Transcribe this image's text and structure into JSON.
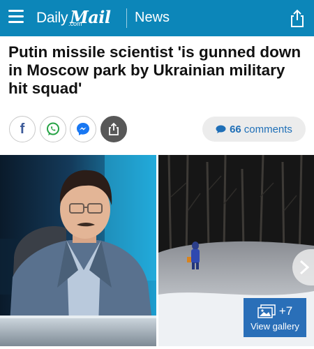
{
  "header": {
    "logo_daily": "Daily",
    "logo_mail": "Mail",
    "logo_com": ".com",
    "section": "News",
    "accent_color": "#0c86b9"
  },
  "article": {
    "headline": "Putin missile scientist 'is gunned down in Moscow park by Ukrainian military hit squad'"
  },
  "share": {
    "buttons": [
      "facebook-icon",
      "whatsapp-icon",
      "messenger-icon",
      "share-icon"
    ]
  },
  "comments": {
    "count": "66",
    "label": "comments"
  },
  "gallery": {
    "count": "+7",
    "label": "View gallery",
    "color": "#2a6fb8"
  }
}
